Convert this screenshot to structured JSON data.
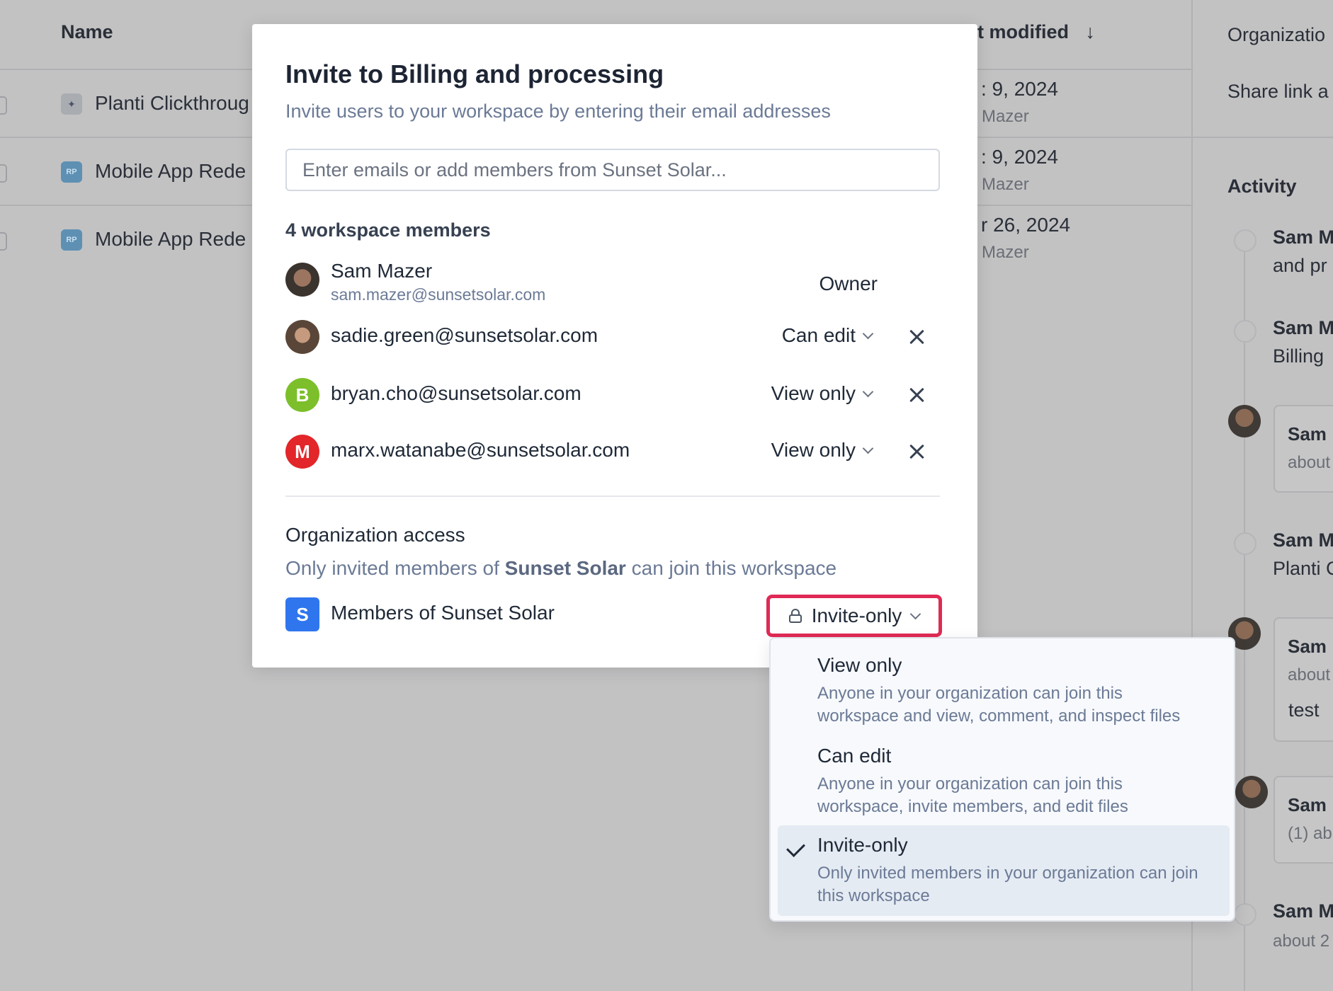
{
  "background": {
    "columns": {
      "name": "Name",
      "last_modified": "t modified"
    },
    "rows": [
      {
        "name": "Planti Clickthroug",
        "icon": "planti-icon",
        "date": ": 9, 2024",
        "author": "Mazer"
      },
      {
        "name": "Mobile App Rede",
        "icon": "RP",
        "date": ": 9, 2024",
        "author": "Mazer"
      },
      {
        "name": "Mobile App Rede",
        "icon": "RP",
        "date": "r 26, 2024",
        "author": "Mazer"
      }
    ],
    "right_panel": {
      "org_label": "Organizatio",
      "share_link": "Share link a",
      "activity_title": "Activity",
      "items": [
        {
          "name": "Sam M",
          "text": "and pr"
        },
        {
          "name": "Sam M",
          "text": "Billing"
        },
        {
          "card_title": "Sam",
          "card_sub": "about"
        },
        {
          "name": "Sam M",
          "text": "Planti C"
        },
        {
          "card_title": "Sam",
          "card_sub": "about",
          "card_body": "test"
        },
        {
          "card_title": "Sam",
          "card_sub": "(1) ab"
        },
        {
          "name": "Sam M",
          "text": "about 2"
        }
      ]
    }
  },
  "modal": {
    "title": "Invite to Billing and processing",
    "subtitle": "Invite users to your workspace by entering their email addresses",
    "email_input_placeholder": "Enter emails or add members from Sunset Solar...",
    "members_heading": "4 workspace members",
    "owner": {
      "name": "Sam Mazer",
      "email": "sam.mazer@sunsetsolar.com",
      "role": "Owner"
    },
    "members": [
      {
        "email": "sadie.green@sunsetsolar.com",
        "role": "Can edit",
        "avatar": "photo"
      },
      {
        "email": "bryan.cho@sunsetsolar.com",
        "role": "View only",
        "avatar": "B",
        "avatar_color": "#7cbf2a"
      },
      {
        "email": "marx.watanabe@sunsetsolar.com",
        "role": "View only",
        "avatar": "M",
        "avatar_color": "#e2262a"
      }
    ],
    "org_access": {
      "title": "Organization access",
      "desc_before": "Only invited members of ",
      "desc_org": "Sunset Solar",
      "desc_after": " can join this workspace",
      "group_avatar": "S",
      "group_label": "Members of Sunset Solar",
      "current_access": "Invite-only"
    }
  },
  "access_menu": {
    "options": [
      {
        "label": "View only",
        "desc_line1": "Anyone in your organization can join this",
        "desc_line2": "workspace and view, comment, and inspect files"
      },
      {
        "label": "Can edit",
        "desc_line1": "Anyone in your organization can join this",
        "desc_line2": "workspace, invite members, and edit files"
      },
      {
        "label": "Invite-only",
        "desc_line1": "Only invited members in your organization can join",
        "desc_line2": "this workspace",
        "selected": true
      }
    ]
  },
  "colors": {
    "highlight_border": "#e02a55",
    "overlay_bg": "#c2c2c3",
    "muted_text": "#6b7a96"
  }
}
